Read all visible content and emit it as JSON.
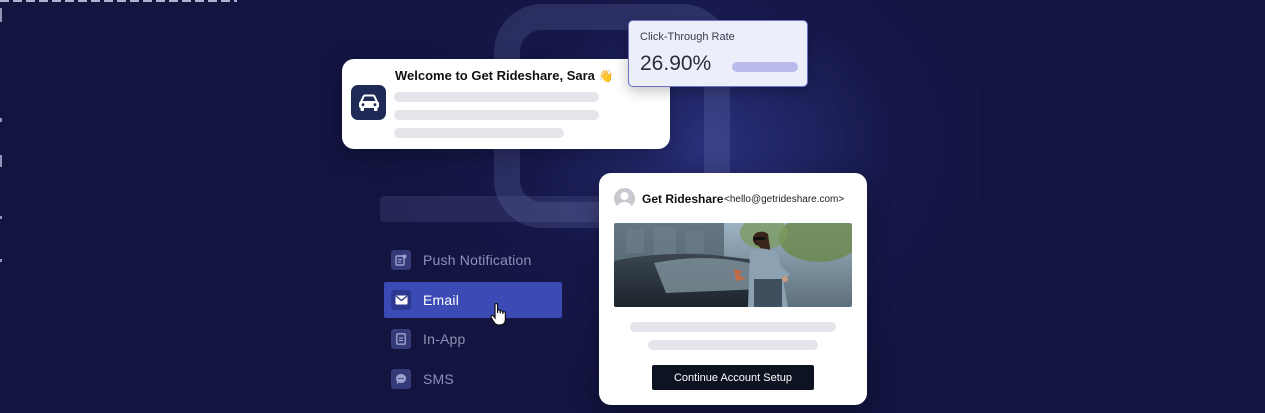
{
  "welcome_card": {
    "title": "Welcome to Get Rideshare, Sara",
    "emoji": "👋",
    "app_icon": "car-icon"
  },
  "ctr_card": {
    "label": "Click-Through Rate",
    "value": "26.90%"
  },
  "channels": [
    {
      "label": "Push Notification",
      "icon": "push-notification-icon",
      "active": false
    },
    {
      "label": "Email",
      "icon": "mail-icon",
      "active": true
    },
    {
      "label": "In-App",
      "icon": "document-icon",
      "active": false
    },
    {
      "label": "SMS",
      "icon": "chat-bubble-icon",
      "active": false
    }
  ],
  "email_card": {
    "sender_name": "Get Rideshare",
    "sender_email": "<hello@getrideshare.com>",
    "cta_label": "Continue Account Setup"
  },
  "colors": {
    "background": "#131440",
    "active_channel": "#3c4ab6",
    "ctr_border": "#6e74c4",
    "cta_button": "#0e1322"
  }
}
